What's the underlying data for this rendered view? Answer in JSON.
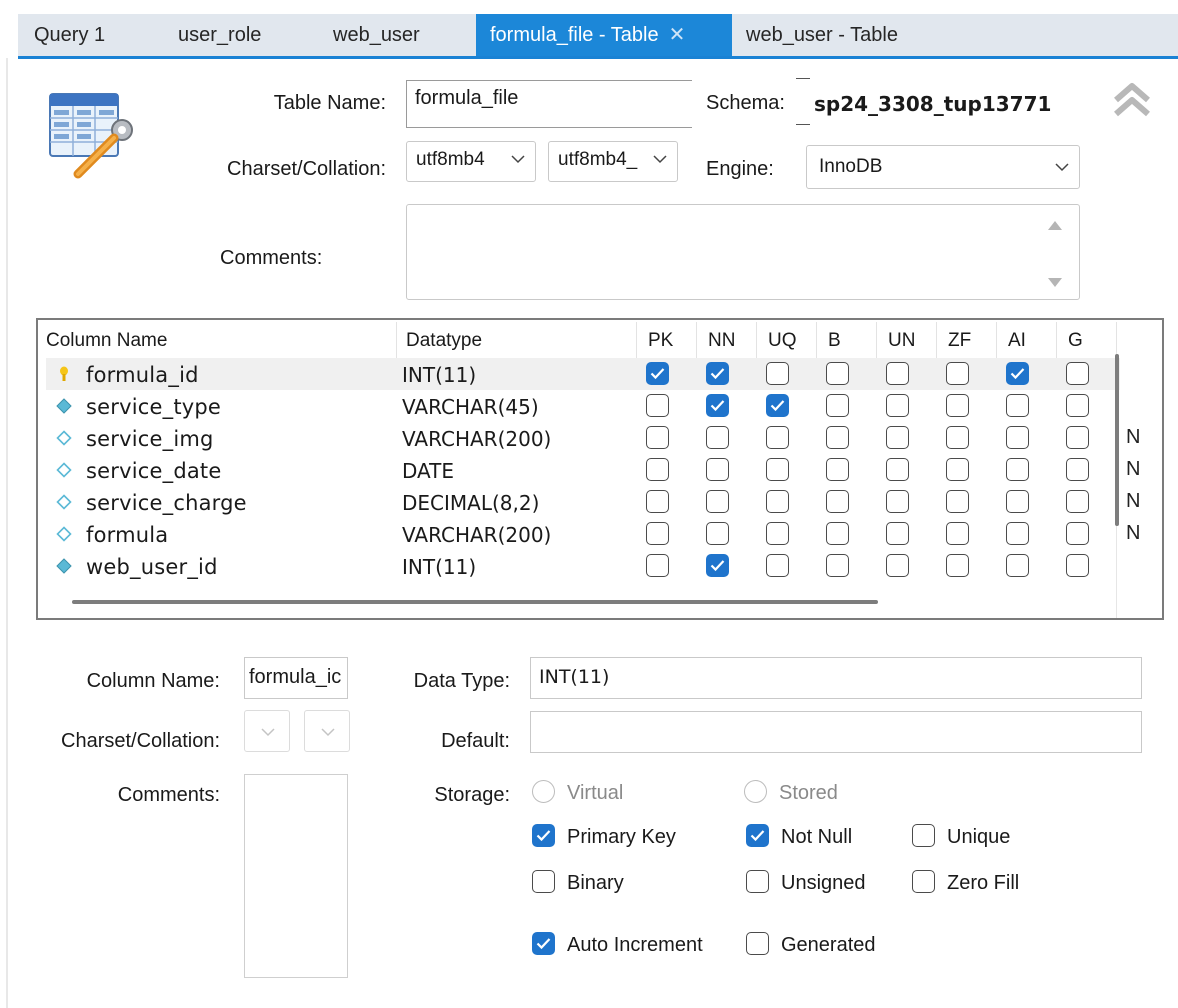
{
  "tabs": [
    {
      "label": "Query 1"
    },
    {
      "label": "user_role"
    },
    {
      "label": "web_user"
    },
    {
      "label": "formula_file - Table",
      "active": true
    },
    {
      "label": "web_user - Table"
    }
  ],
  "table_form": {
    "table_name_label": "Table Name:",
    "table_name_value": "formula_file",
    "schema_label": "Schema:",
    "schema_value": "sp24_3308_tup13771",
    "charset_label": "Charset/Collation:",
    "charset_value": "utf8mb4",
    "collation_value": "utf8mb4_",
    "engine_label": "Engine:",
    "engine_value": "InnoDB",
    "comments_label": "Comments:",
    "comments_value": ""
  },
  "grid": {
    "headers": {
      "column_name": "Column Name",
      "datatype": "Datatype",
      "pk": "PK",
      "nn": "NN",
      "uq": "UQ",
      "b": "B",
      "un": "UN",
      "zf": "ZF",
      "ai": "AI",
      "g": "G"
    },
    "rows": [
      {
        "name": "formula_id",
        "type": "INT(11)",
        "icon": "primary-key-icon",
        "pk": true,
        "nn": true,
        "uq": false,
        "b": false,
        "un": false,
        "zf": false,
        "ai": true,
        "g": false,
        "extra": ""
      },
      {
        "name": "service_type",
        "type": "VARCHAR(45)",
        "icon": "not-null-column-icon",
        "pk": false,
        "nn": true,
        "uq": true,
        "b": false,
        "un": false,
        "zf": false,
        "ai": false,
        "g": false,
        "extra": ""
      },
      {
        "name": "service_img",
        "type": "VARCHAR(200)",
        "icon": "nullable-column-icon",
        "pk": false,
        "nn": false,
        "uq": false,
        "b": false,
        "un": false,
        "zf": false,
        "ai": false,
        "g": false,
        "extra": "N"
      },
      {
        "name": "service_date",
        "type": "DATE",
        "icon": "nullable-column-icon",
        "pk": false,
        "nn": false,
        "uq": false,
        "b": false,
        "un": false,
        "zf": false,
        "ai": false,
        "g": false,
        "extra": "N"
      },
      {
        "name": "service_charge",
        "type": "DECIMAL(8,2)",
        "icon": "nullable-column-icon",
        "pk": false,
        "nn": false,
        "uq": false,
        "b": false,
        "un": false,
        "zf": false,
        "ai": false,
        "g": false,
        "extra": "N"
      },
      {
        "name": "formula",
        "type": "VARCHAR(200)",
        "icon": "nullable-column-icon",
        "pk": false,
        "nn": false,
        "uq": false,
        "b": false,
        "un": false,
        "zf": false,
        "ai": false,
        "g": false,
        "extra": "N"
      },
      {
        "name": "web_user_id",
        "type": "INT(11)",
        "icon": "not-null-column-icon",
        "pk": false,
        "nn": true,
        "uq": false,
        "b": false,
        "un": false,
        "zf": false,
        "ai": false,
        "g": false,
        "extra": ""
      }
    ]
  },
  "column_form": {
    "column_name_label": "Column Name:",
    "column_name_value": "formula_ic",
    "data_type_label": "Data Type:",
    "data_type_value": "INT(11)",
    "charset_label": "Charset/Collation:",
    "default_label": "Default:",
    "default_value": "",
    "comments_label": "Comments:",
    "storage_label": "Storage:",
    "virtual_label": "Virtual",
    "stored_label": "Stored",
    "primary_key_label": "Primary Key",
    "primary_key_checked": true,
    "not_null_label": "Not Null",
    "not_null_checked": true,
    "unique_label": "Unique",
    "unique_checked": false,
    "binary_label": "Binary",
    "binary_checked": false,
    "unsigned_label": "Unsigned",
    "unsigned_checked": false,
    "zero_fill_label": "Zero Fill",
    "zero_fill_checked": false,
    "auto_increment_label": "Auto Increment",
    "auto_increment_checked": true,
    "generated_label": "Generated",
    "generated_checked": false
  },
  "colors": {
    "accent": "#1c87d8",
    "checkbox_checked": "#1f74cc",
    "tab_strip": "#e1e7ee"
  }
}
